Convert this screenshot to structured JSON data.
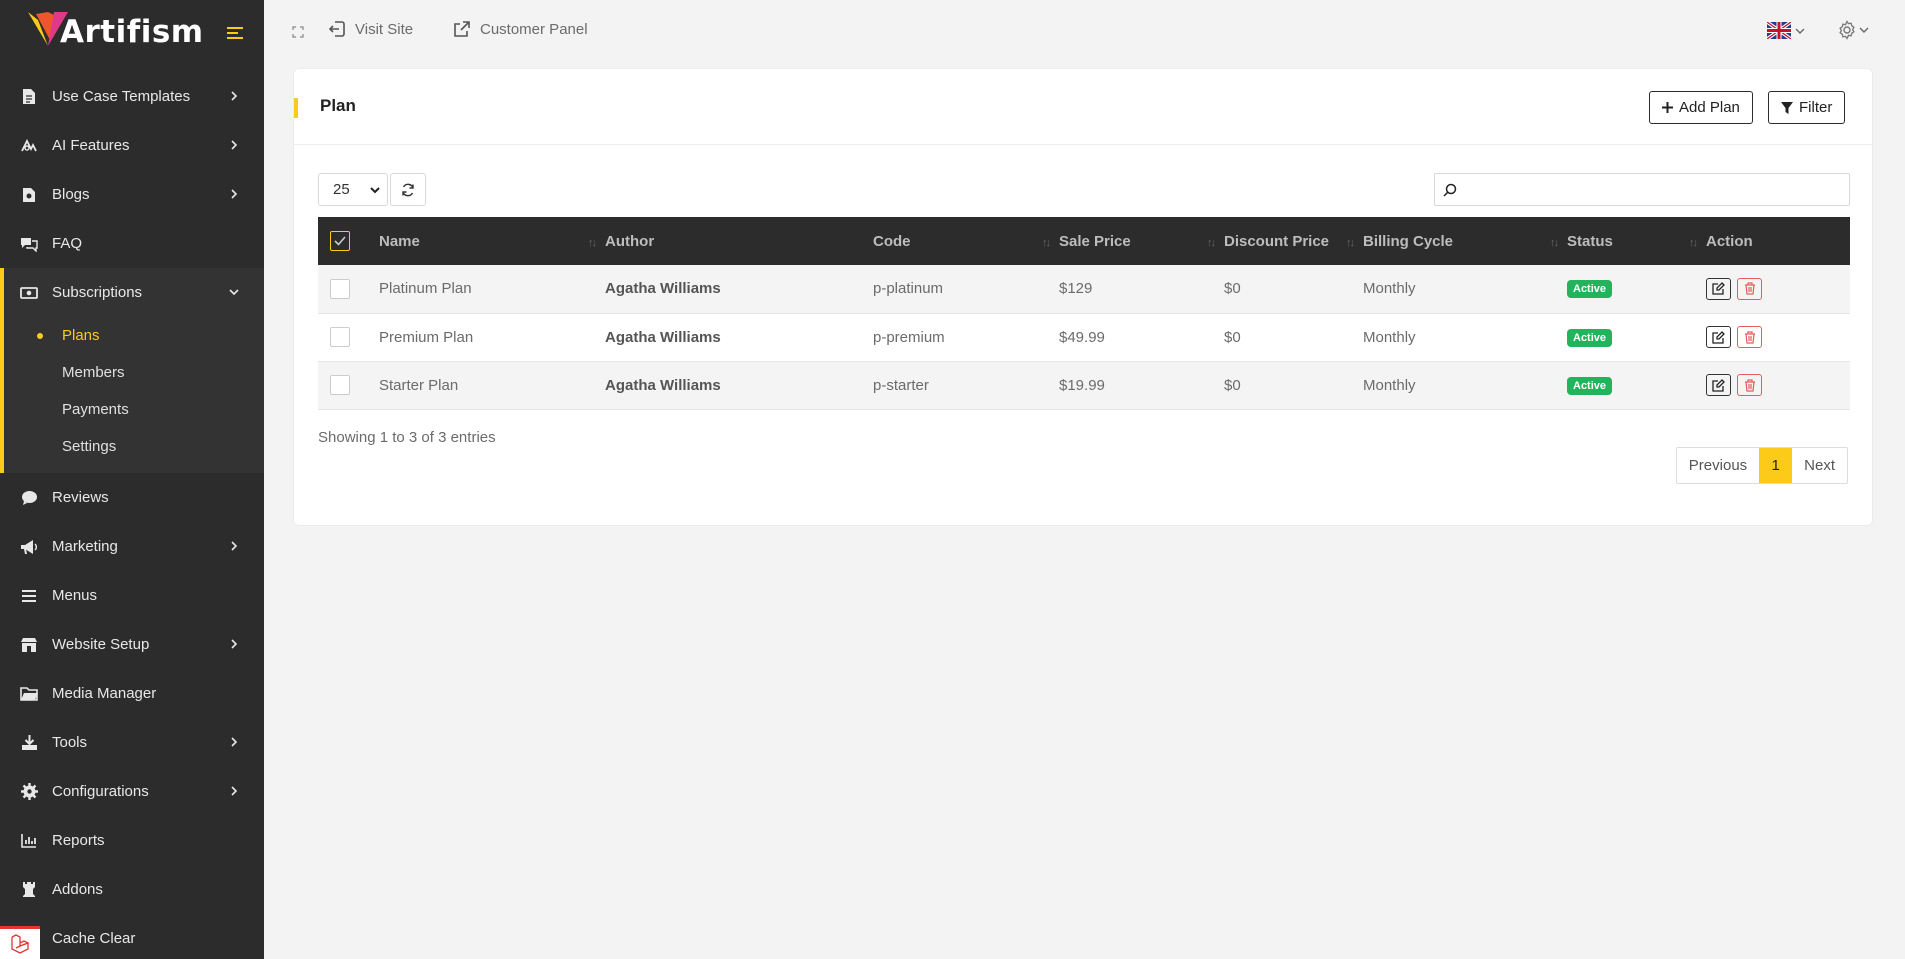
{
  "app": {
    "brand": "Artifism"
  },
  "sidebar": {
    "items": [
      {
        "label": "Use Case Templates",
        "icon": "file-icon",
        "chevron": true
      },
      {
        "label": "AI Features",
        "icon": "ai-icon",
        "chevron": true
      },
      {
        "label": "Blogs",
        "icon": "blog-icon",
        "chevron": true
      },
      {
        "label": "FAQ",
        "icon": "chat-icon",
        "chevron": false
      }
    ],
    "subscriptions": {
      "label": "Subscriptions",
      "icon": "money-icon",
      "children": [
        "Plans",
        "Members",
        "Payments",
        "Settings"
      ],
      "active": "Plans"
    },
    "items_after": [
      {
        "label": "Reviews",
        "icon": "comment-icon",
        "chevron": false
      },
      {
        "label": "Marketing",
        "icon": "megaphone-icon",
        "chevron": true
      },
      {
        "label": "Menus",
        "icon": "list-icon",
        "chevron": false
      },
      {
        "label": "Website Setup",
        "icon": "store-icon",
        "chevron": true
      },
      {
        "label": "Media Manager",
        "icon": "folder-icon",
        "chevron": false
      },
      {
        "label": "Tools",
        "icon": "download-icon",
        "chevron": true
      },
      {
        "label": "Configurations",
        "icon": "gear-icon",
        "chevron": true
      },
      {
        "label": "Reports",
        "icon": "chart-icon",
        "chevron": false
      },
      {
        "label": "Addons",
        "icon": "rook-icon",
        "chevron": false
      },
      {
        "label": "Cache Clear",
        "icon": "broom-icon",
        "chevron": false
      }
    ]
  },
  "topbar": {
    "visit_site": "Visit Site",
    "customer_panel": "Customer Panel",
    "language_flag": "uk-flag-icon",
    "settings_icon": "gear-icon"
  },
  "card": {
    "title": "Plan",
    "add_button": "Add Plan",
    "filter_button": "Filter",
    "per_page": "25",
    "search_placeholder": ""
  },
  "table": {
    "columns": [
      "Name",
      "Author",
      "Code",
      "Sale Price",
      "Discount Price",
      "Billing Cycle",
      "Status",
      "Action"
    ],
    "rows": [
      {
        "name": "Platinum Plan",
        "author": "Agatha Williams",
        "code": "p-platinum",
        "sale_price": "$129",
        "discount_price": "$0",
        "billing_cycle": "Monthly",
        "status": "Active"
      },
      {
        "name": "Premium Plan",
        "author": "Agatha Williams",
        "code": "p-premium",
        "sale_price": "$49.99",
        "discount_price": "$0",
        "billing_cycle": "Monthly",
        "status": "Active"
      },
      {
        "name": "Starter Plan",
        "author": "Agatha Williams",
        "code": "p-starter",
        "sale_price": "$19.99",
        "discount_price": "$0",
        "billing_cycle": "Monthly",
        "status": "Active"
      }
    ]
  },
  "footer": {
    "showing": "Showing 1 to 3 of 3 entries",
    "previous": "Previous",
    "current_page": "1",
    "next": "Next"
  },
  "colors": {
    "accent": "#fcca19",
    "sidebar": "#2c2c2c",
    "active_badge": "#22b35c"
  }
}
